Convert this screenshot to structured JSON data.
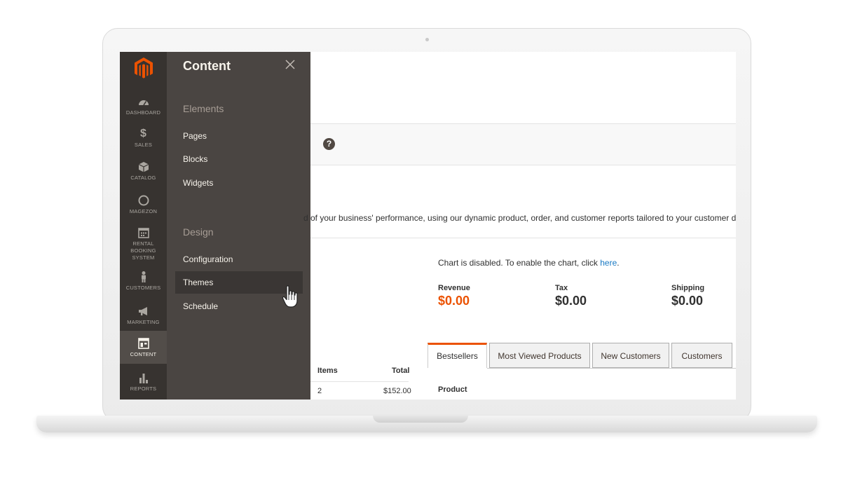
{
  "sidebar": {
    "items": [
      {
        "label": "DASHBOARD",
        "icon": "dashboard-icon"
      },
      {
        "label": "SALES",
        "icon": "dollar-icon"
      },
      {
        "label": "CATALOG",
        "icon": "box-icon"
      },
      {
        "label": "MAGEZON",
        "icon": "circle-icon"
      },
      {
        "label": "RENTAL BOOKING SYSTEM",
        "icon": "calendar-icon"
      },
      {
        "label": "CUSTOMERS",
        "icon": "person-icon"
      },
      {
        "label": "MARKETING",
        "icon": "megaphone-icon"
      },
      {
        "label": "CONTENT",
        "icon": "layout-icon"
      },
      {
        "label": "REPORTS",
        "icon": "bar-chart-icon"
      }
    ],
    "active": "CONTENT"
  },
  "flyout": {
    "title": "Content",
    "sections": [
      {
        "title": "Elements",
        "links": [
          "Pages",
          "Blocks",
          "Widgets"
        ]
      },
      {
        "title": "Design",
        "links": [
          "Configuration",
          "Themes",
          "Schedule"
        ]
      }
    ],
    "hovered": "Themes"
  },
  "dashboard": {
    "description": "d of your business' performance, using our dynamic product, order, and customer reports tailored to your customer data.",
    "chart_message": "Chart is disabled. To enable the chart, click ",
    "chart_link": "here",
    "chart_suffix": ".",
    "stats": {
      "revenue_label": "Revenue",
      "revenue_value": "$0.00",
      "tax_label": "Tax",
      "tax_value": "$0.00",
      "shipping_label": "Shipping",
      "shipping_value": "$0.00"
    },
    "orders_table": {
      "headers": [
        "Items",
        "Total"
      ],
      "rows": [
        [
          "2",
          "$152.00"
        ]
      ]
    },
    "tabs": [
      "Bestsellers",
      "Most Viewed Products",
      "New Customers",
      "Customers"
    ],
    "active_tab": "Bestsellers",
    "tab_content_header": "Product"
  },
  "colors": {
    "accent": "#eb5202",
    "rail": "#373330",
    "flyout": "#4a4542",
    "link": "#1979c3"
  }
}
